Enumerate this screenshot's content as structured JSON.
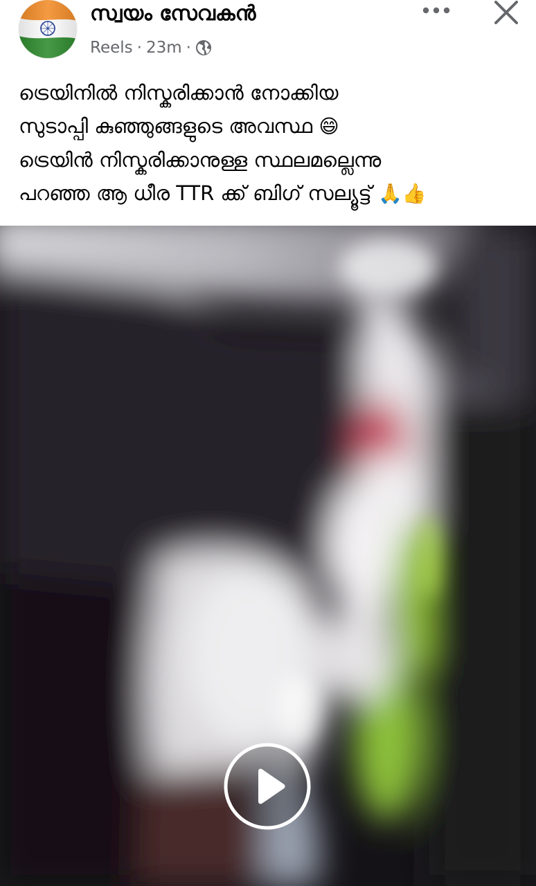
{
  "post": {
    "page_name": "സ്വയം സേവകൻ",
    "meta": {
      "type": "Reels",
      "separator": "·",
      "time": "23m",
      "separator2": "·",
      "privacy_icon": "globe-icon"
    },
    "menu_icon": "more-horizontal-icon",
    "close_icon": "close-icon",
    "caption": {
      "line1": "ട്രെയിനിൽ നിസ്കരിക്കാൻ നോക്കിയ",
      "line2": "സുടാപ്പി കുഞ്ഞുങ്ങളുടെ അവസ്ഥ",
      "line2_emoji": "😄",
      "line3": "ട്രെയിൻ നിസ്കരിക്കാനുള്ള സ്ഥലമല്ലെന്നു",
      "line4": "പറഞ്ഞ ആ ധീര TTR ക്ക് ബിഗ് സല്യൂട്ട്",
      "line4_emoji": "🙏👍"
    },
    "video": {
      "play_icon": "play-icon"
    },
    "colors": {
      "text_primary": "#050505",
      "text_secondary": "#65676b",
      "flag_saffron": "#f28c28",
      "flag_green": "#2e8b2e",
      "flag_chakra": "#1f3a93"
    }
  }
}
